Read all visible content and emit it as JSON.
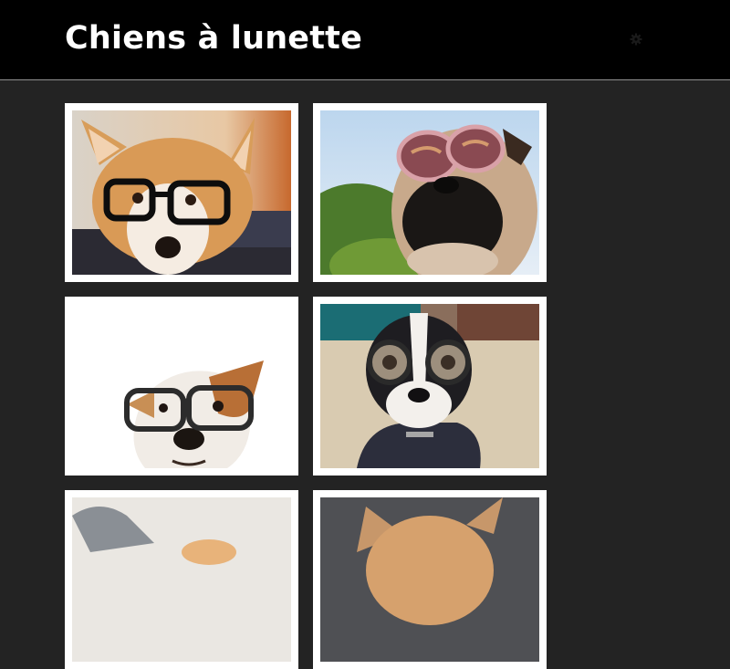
{
  "header": {
    "title": "Chiens à lunette",
    "background": "#000000",
    "settings_icon": "gear-icon"
  },
  "gallery": {
    "background": "#232323",
    "frame_color": "#ffffff",
    "photos": [
      {
        "subject": "corgi wearing black glasses"
      },
      {
        "subject": "pug wearing pink aviator sunglasses"
      },
      {
        "subject": "terrier wearing black glasses"
      },
      {
        "subject": "boston terrier wearing round goggle glasses"
      },
      {
        "subject": "dog photo (partially visible)"
      },
      {
        "subject": "dog photo (partially visible)"
      }
    ]
  }
}
